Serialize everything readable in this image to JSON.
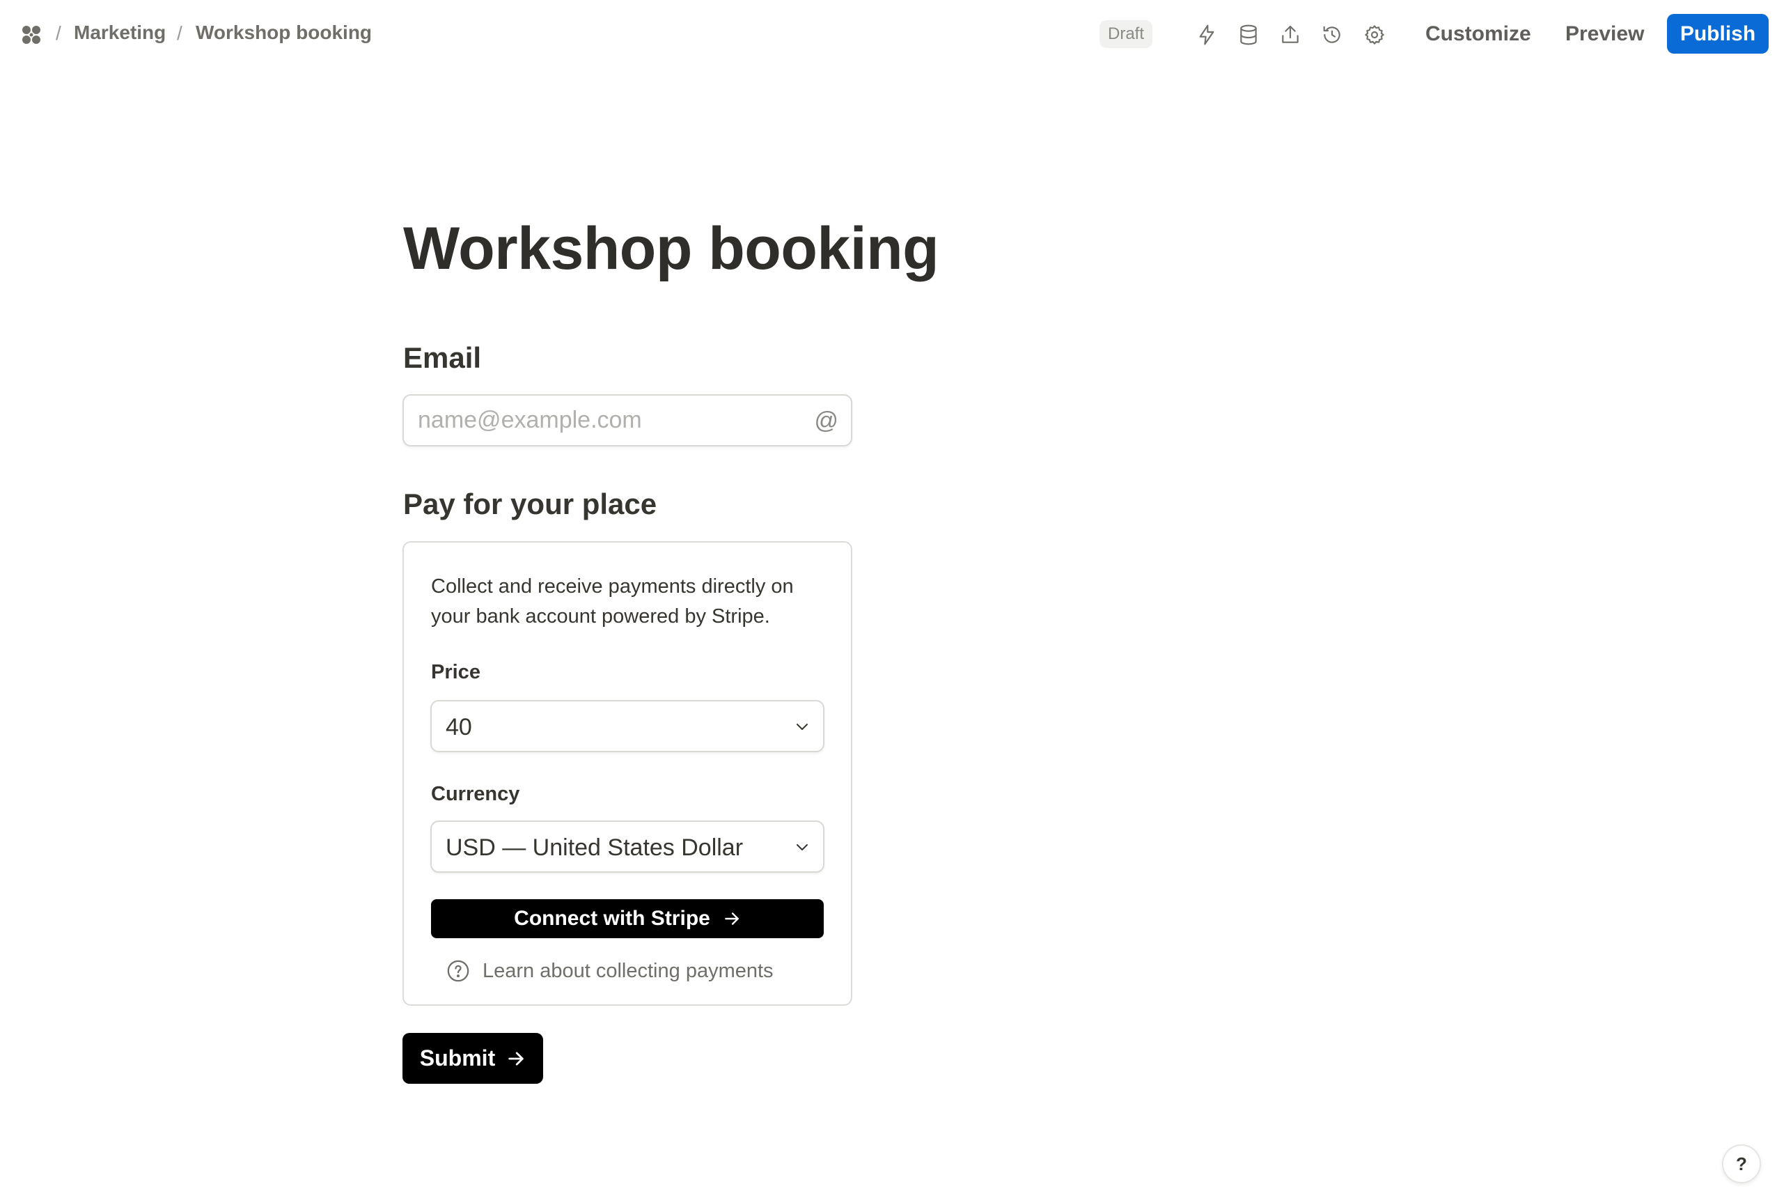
{
  "breadcrumb": {
    "items": [
      "Marketing",
      "Workshop booking"
    ],
    "separator": "/"
  },
  "header": {
    "status": "Draft",
    "icons": [
      "lightning-icon",
      "database-icon",
      "share-icon",
      "history-icon",
      "settings-icon"
    ],
    "customize_label": "Customize",
    "preview_label": "Preview",
    "publish_label": "Publish",
    "publish_color": "#0b6bd6"
  },
  "form": {
    "title": "Workshop booking",
    "email": {
      "label": "Email",
      "placeholder": "name@example.com",
      "value": "",
      "icon": "@"
    },
    "payment": {
      "label": "Pay for your place",
      "description": "Collect and receive payments directly on your bank account powered by Stripe.",
      "price_label": "Price",
      "price_value": "40",
      "currency_label": "Currency",
      "currency_value": "USD — United States Dollar",
      "connect_label": "Connect with Stripe",
      "learn_label": "Learn about collecting payments"
    },
    "submit_label": "Submit"
  },
  "help_label": "?"
}
